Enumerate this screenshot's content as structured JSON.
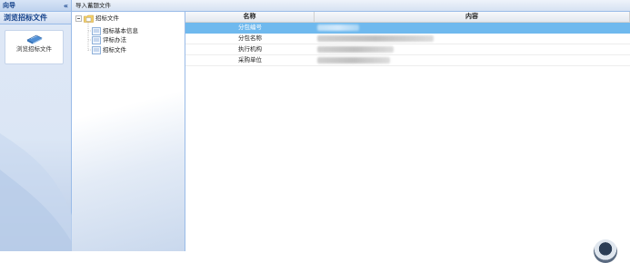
{
  "nav": {
    "title": "向导",
    "collapse_glyph": "«",
    "section_title": "浏览招标文件",
    "tile_label": "浏览招标文件",
    "tile_icon": "document-book-icon"
  },
  "toolbar": {
    "import_label": "导入蓄题文件"
  },
  "tree": {
    "root_label": "招标文件",
    "children": [
      "招标基本信息",
      "评标办法",
      "招标文件"
    ]
  },
  "grid": {
    "columns": [
      "名称",
      "内容"
    ],
    "rows": [
      {
        "name": "分包编号",
        "value": "",
        "selected": true
      },
      {
        "name": "分包名称",
        "value": "",
        "selected": false
      },
      {
        "name": "执行机构",
        "value": "",
        "selected": false
      },
      {
        "name": "采购单位",
        "value": "",
        "selected": false
      }
    ]
  },
  "colors": {
    "accent": "#6fb9ee",
    "border": "#99bbe8",
    "header_text": "#15428b"
  }
}
